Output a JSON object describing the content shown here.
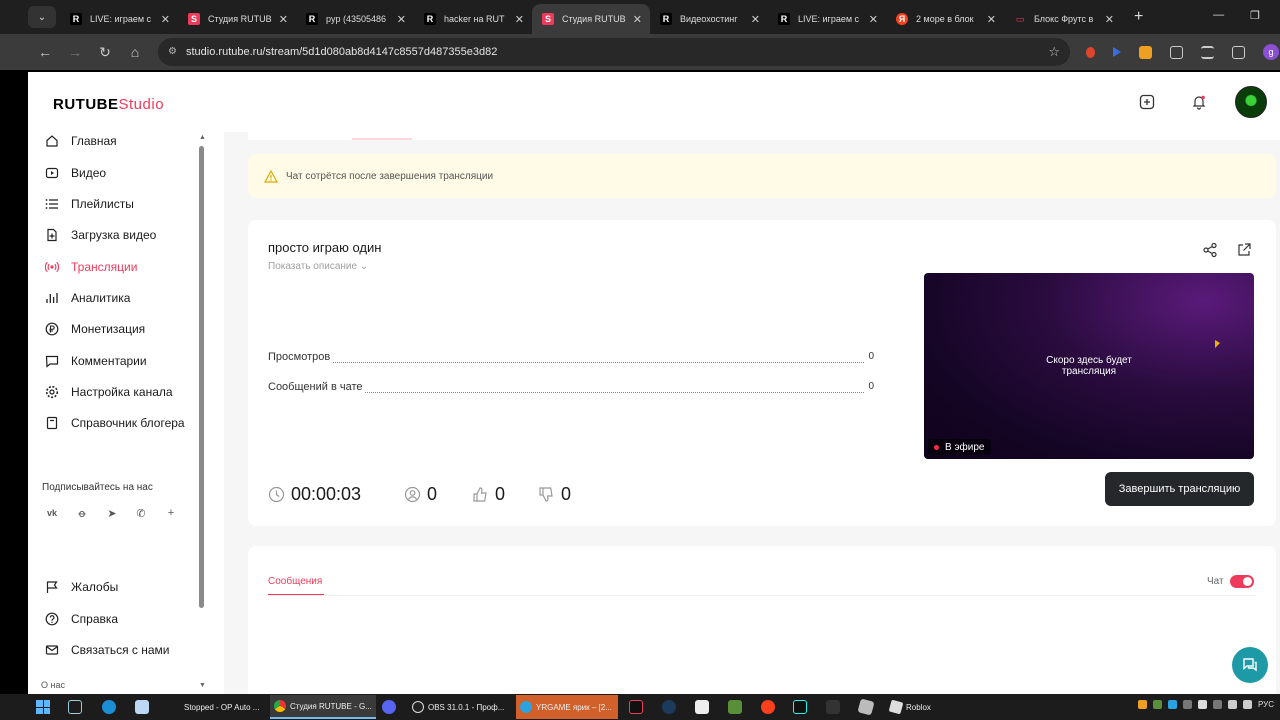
{
  "browser": {
    "tabs": [
      {
        "title": "LIVE: играем с",
        "favicon": "R",
        "color": "#ef3b5b"
      },
      {
        "title": "Студия RUTUB",
        "favicon": "S",
        "color": "#ef3b5b"
      },
      {
        "title": "pyp (43505486",
        "favicon": "R",
        "color": "#ef3b5b"
      },
      {
        "title": "hacker на RUT",
        "favicon": "R",
        "color": "#ef3b5b"
      },
      {
        "title": "Студия RUTUB",
        "favicon": "S",
        "color": "#ef3b5b",
        "active": true
      },
      {
        "title": "Видеохостинг",
        "favicon": "R",
        "color": "#ef3b5b"
      },
      {
        "title": "LIVE: играем с",
        "favicon": "R",
        "color": "#ef3b5b"
      },
      {
        "title": "2 море в блок",
        "favicon": "Я",
        "color": "#fc3f1d"
      },
      {
        "title": "Блокс Фрутс в",
        "favicon": "▭",
        "color": "#ef3b5b"
      }
    ],
    "url": "studio.rutube.ru/stream/5d1d080ab8d4147c8557d487355e3d82"
  },
  "app": {
    "logo_main": "RUTUBE",
    "logo_studio": "Studio",
    "accent": "#ef3b5b"
  },
  "sidebar": {
    "items": [
      {
        "label": "Главная",
        "icon": "home-icon"
      },
      {
        "label": "Видео",
        "icon": "video-icon"
      },
      {
        "label": "Плейлисты",
        "icon": "playlist-icon"
      },
      {
        "label": "Загрузка видео",
        "icon": "upload-icon"
      },
      {
        "label": "Трансляции",
        "icon": "broadcast-icon",
        "active": true
      },
      {
        "label": "Аналитика",
        "icon": "analytics-icon"
      },
      {
        "label": "Монетизация",
        "icon": "ruble-icon"
      },
      {
        "label": "Комментарии",
        "icon": "comment-icon"
      },
      {
        "label": "Настройка канала",
        "icon": "gear-icon"
      },
      {
        "label": "Справочник блогера",
        "icon": "book-icon"
      }
    ],
    "follow_label": "Подписывайтесь на нас",
    "social": [
      "vk-icon",
      "odnoklassniki-icon",
      "telegram-icon",
      "viber-icon",
      "plus-icon"
    ],
    "bottom_items": [
      {
        "label": "Жалобы",
        "icon": "flag-icon"
      },
      {
        "label": "Справка",
        "icon": "help-icon"
      },
      {
        "label": "Связаться с нами",
        "icon": "mail-icon"
      }
    ],
    "about": "О нас"
  },
  "main": {
    "alert": "Чат сотрётся после завершения трансляции",
    "stream_title": "просто играю один",
    "show_description": "Показать описание",
    "stats": [
      {
        "label": "Просмотров",
        "value": "0"
      },
      {
        "label": "Сообщений в чате",
        "value": "0"
      }
    ],
    "preview_text_line1": "Скоро здесь будет",
    "preview_text_line2": "трансляция",
    "live_badge": "В эфире",
    "timer": "00:00:03",
    "viewers": "0",
    "likes": "0",
    "dislikes": "0",
    "end_button": "Завершить трансляцию",
    "messages_tab": "Сообщения",
    "chat_toggle_label": "Чат",
    "chat_enabled": true
  },
  "taskbar": {
    "apps": [
      {
        "label": "Stopped - OP Auto ..."
      },
      {
        "label": "Студия RUTUBE - G...",
        "active": true
      },
      {
        "label": "OBS 31.0.1 - Проф..."
      },
      {
        "label": "YRGAME ярик – [2...",
        "flash": true
      },
      {
        "label": "Roblox"
      }
    ],
    "lang": "РУС"
  }
}
